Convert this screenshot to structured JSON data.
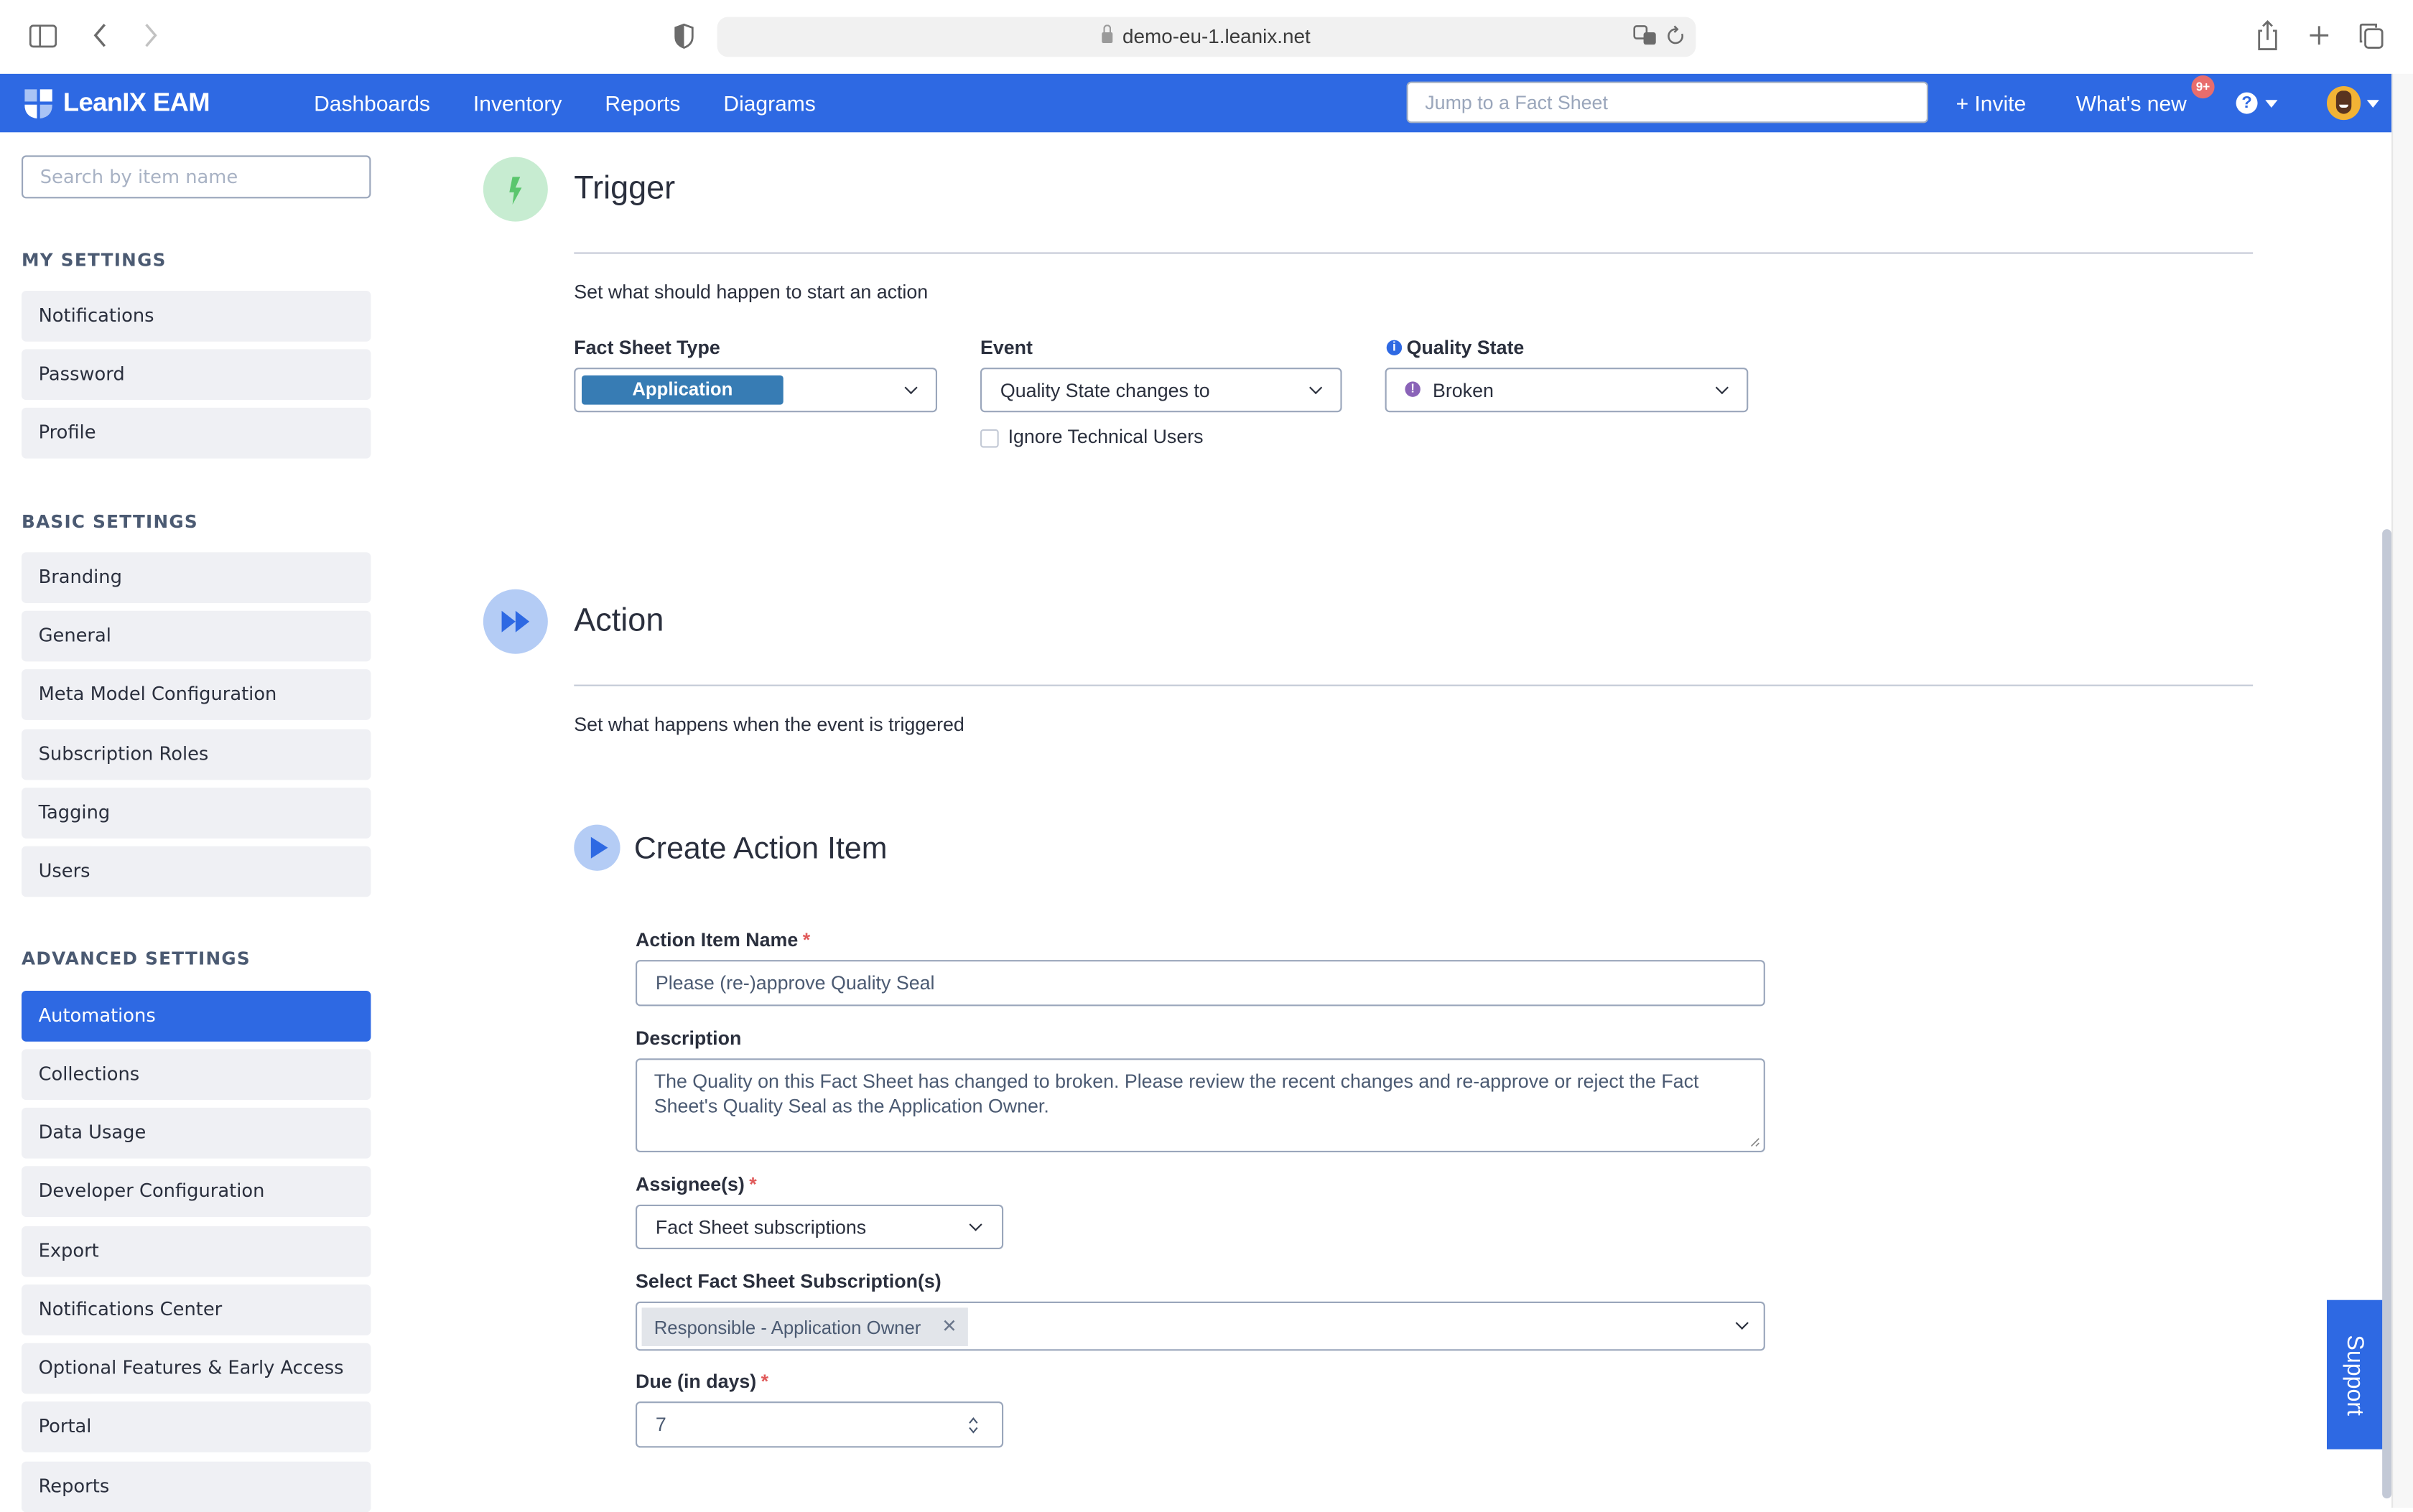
{
  "browser": {
    "url": "demo-eu-1.leanix.net",
    "icons": [
      "sidebar-toggle-icon",
      "back-icon",
      "forward-icon",
      "shield-icon",
      "lock-icon",
      "translate-icon",
      "reload-icon",
      "share-icon",
      "new-tab-icon",
      "tabs-overview-icon"
    ]
  },
  "header": {
    "brand": "LeanIX EAM",
    "nav": [
      {
        "label": "Dashboards"
      },
      {
        "label": "Inventory"
      },
      {
        "label": "Reports"
      },
      {
        "label": "Diagrams"
      }
    ],
    "jump_placeholder": "Jump to a Fact Sheet",
    "invite_label": "+ Invite",
    "whats_new_label": "What's new",
    "whats_new_badge": "9+",
    "help_glyph": "?",
    "brand_color": "#2e69e3"
  },
  "sidebar": {
    "search_placeholder": "Search by item name",
    "groups": [
      {
        "title": "MY SETTINGS",
        "items": [
          {
            "label": "Notifications"
          },
          {
            "label": "Password"
          },
          {
            "label": "Profile"
          }
        ]
      },
      {
        "title": "BASIC SETTINGS",
        "items": [
          {
            "label": "Branding"
          },
          {
            "label": "General"
          },
          {
            "label": "Meta Model Configuration"
          },
          {
            "label": "Subscription Roles"
          },
          {
            "label": "Tagging"
          },
          {
            "label": "Users"
          }
        ]
      },
      {
        "title": "ADVANCED SETTINGS",
        "items": [
          {
            "label": "Automations",
            "active": true
          },
          {
            "label": "Collections"
          },
          {
            "label": "Data Usage"
          },
          {
            "label": "Developer Configuration"
          },
          {
            "label": "Export"
          },
          {
            "label": "Notifications Center"
          },
          {
            "label": "Optional Features & Early Access"
          },
          {
            "label": "Portal"
          },
          {
            "label": "Reports"
          }
        ]
      }
    ]
  },
  "trigger": {
    "title": "Trigger",
    "subtitle": "Set what should happen to start an action",
    "fact_sheet_type": {
      "label": "Fact Sheet Type",
      "value": "Application",
      "tag_color": "#377cb4"
    },
    "event": {
      "label": "Event",
      "value": "Quality State changes to"
    },
    "ignore_technical_users": {
      "label": "Ignore Technical Users",
      "checked": false
    },
    "quality_state": {
      "label": "Quality State",
      "value": "Broken",
      "status_color": "#8a63b8"
    }
  },
  "action": {
    "title": "Action",
    "subtitle": "Set what happens when the event is triggered",
    "create_action_item": {
      "title": "Create Action Item",
      "name_label": "Action Item Name",
      "name_value": "Please (re-)approve Quality Seal",
      "description_label": "Description",
      "description_value": "The Quality on this Fact Sheet has changed to broken. Please review the recent changes and re-approve or reject the Fact Sheet's Quality Seal as the Application Owner.",
      "assignees_label": "Assignee(s)",
      "assignees_value": "Fact Sheet subscriptions",
      "subscriptions_label": "Select Fact Sheet Subscription(s)",
      "subscriptions_selected": [
        "Responsible - Application Owner"
      ],
      "due_label": "Due (in days)",
      "due_value": "7",
      "required_mark": "*"
    }
  },
  "support_label": "Support"
}
